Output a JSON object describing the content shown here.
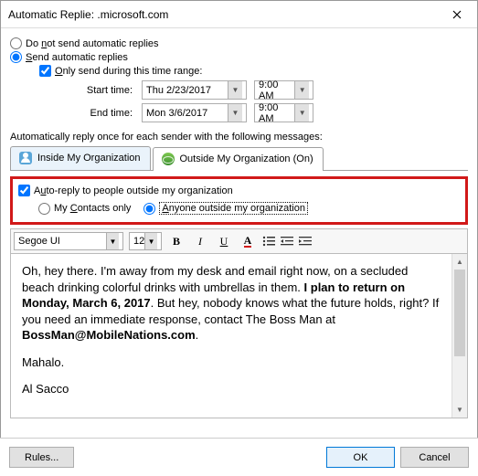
{
  "title": "Automatic Replie:           .microsoft.com",
  "radios": {
    "no_send": "Do not send automatic replies",
    "send": "Send automatic replies"
  },
  "only_range": "Only send during this time range:",
  "start_label": "Start time:",
  "end_label": "End time:",
  "start_date": "Thu 2/23/2017",
  "start_time": "9:00 AM",
  "end_date": "Mon 3/6/2017",
  "end_time": "9:00 AM",
  "auto_reply_label": "Automatically reply once for each sender with the following messages:",
  "tabs": {
    "inside": "Inside My Organization",
    "outside": "Outside My Organization (On)"
  },
  "outside_opts": {
    "check": "Auto-reply to people outside my organization",
    "contacts": "My Contacts only",
    "anyone": "Anyone outside my organization"
  },
  "toolbar": {
    "font": "Segoe UI",
    "size": "12"
  },
  "message": {
    "p1a": "Oh, hey there. I'm away from my desk and email right now, on a secluded beach drinking colorful drinks with umbrellas in them. ",
    "p1b": "I plan to return on Monday, March 6, 2017",
    "p1c": ". But hey, nobody knows what the future holds, right? If you need an immediate response, contact The Boss Man at ",
    "p1d": "BossMan@MobileNations.com",
    "p1e": ".",
    "p2": "Mahalo.",
    "p3": "Al Sacco"
  },
  "buttons": {
    "rules": "Rules...",
    "ok": "OK",
    "cancel": "Cancel"
  }
}
